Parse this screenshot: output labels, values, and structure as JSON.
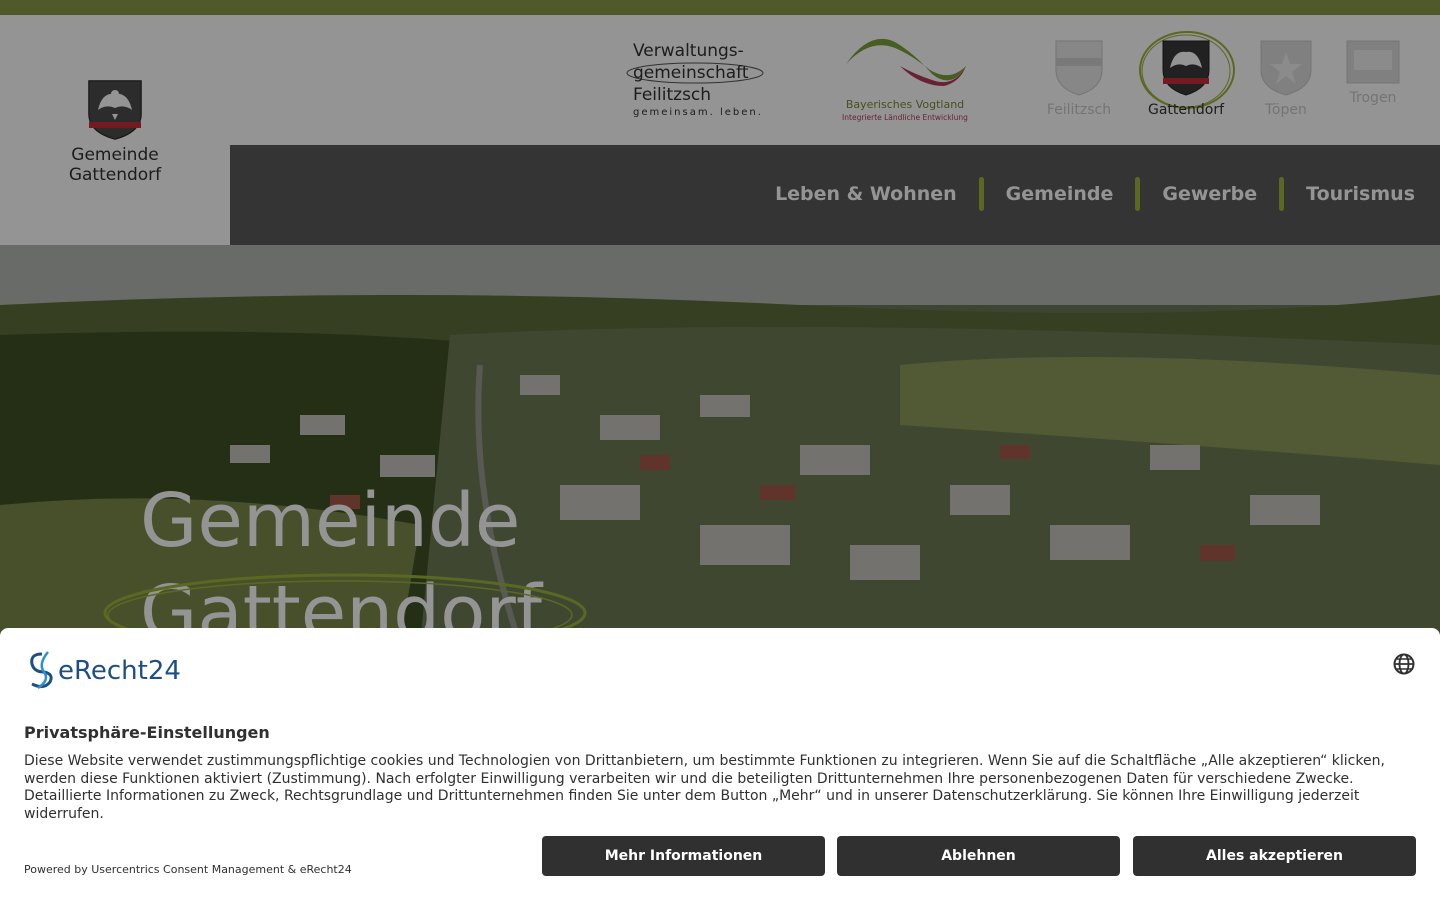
{
  "site": {
    "logo_line1": "Gemeinde",
    "logo_line2": "Gattendorf",
    "partner_vg": {
      "line1": "Verwaltungs-",
      "line2": "gemeinschaft",
      "line3": "Feilitzsch",
      "slogan": "gemeinsam. leben."
    },
    "partner_bv": {
      "line1": "Bayerisches Vogtland",
      "line2": "Integrierte Ländliche Entwicklung"
    },
    "towns": [
      {
        "label": "Feilitzsch",
        "active": false
      },
      {
        "label": "Gattendorf",
        "active": true
      },
      {
        "label": "Töpen",
        "active": false
      },
      {
        "label": "Trogen",
        "active": false
      }
    ],
    "nav": [
      {
        "label": "Leben & Wohnen"
      },
      {
        "label": "Gemeinde"
      },
      {
        "label": "Gewerbe"
      },
      {
        "label": "Tourismus"
      }
    ],
    "hero": {
      "line1": "Gemeinde",
      "line2": "Gattendorf"
    }
  },
  "consent": {
    "brand": "eRecht24",
    "title": "Privatsphäre-Einstellungen",
    "description": "Diese Website verwendet zustimmungspflichtige cookies und Technologien von Drittanbietern, um bestimmte Funktionen zu integrieren. Wenn Sie auf die Schaltfläche „Alle akzeptieren“ klicken, werden diese Funktionen aktiviert (Zustimmung). Nach erfolgter Einwilligung verarbeiten wir und die beteiligten Drittunternehmen Ihre personenbezogenen Daten für verschiedene Zwecke. Detaillierte Informationen zu Zweck, Rechtsgrundlage und Drittunternehmen finden Sie unter dem Button „Mehr“ und in unserer Datenschutzerklärung. Sie können Ihre Einwilligung jederzeit widerrufen.",
    "powered_by": "Powered by Usercentrics Consent Management & eRecht24",
    "buttons": {
      "more": "Mehr Informationen",
      "deny": "Ablehnen",
      "accept": "Alles akzeptieren"
    },
    "language_icon": "globe-icon"
  },
  "colors": {
    "accent_green": "#9eb33a",
    "topbar": "#8a9a49",
    "nav_bg": "#5a5a5a",
    "button_bg": "#303030",
    "brand_blue": "#1d4f86"
  }
}
